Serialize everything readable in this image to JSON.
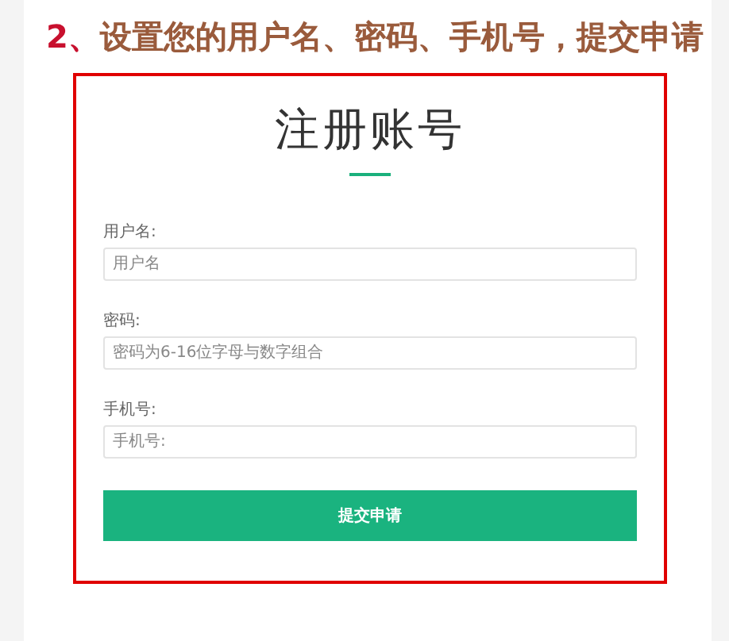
{
  "heading": {
    "number": "2、",
    "text": "设置您的用户名、密码、手机号，提交申请"
  },
  "form": {
    "title": "注册账号",
    "fields": [
      {
        "label": "用户名:",
        "placeholder": "用户名"
      },
      {
        "label": "密码:",
        "placeholder": "密码为6-16位字母与数字组合"
      },
      {
        "label": "手机号:",
        "placeholder": "手机号:"
      }
    ],
    "submit": "提交申请"
  }
}
